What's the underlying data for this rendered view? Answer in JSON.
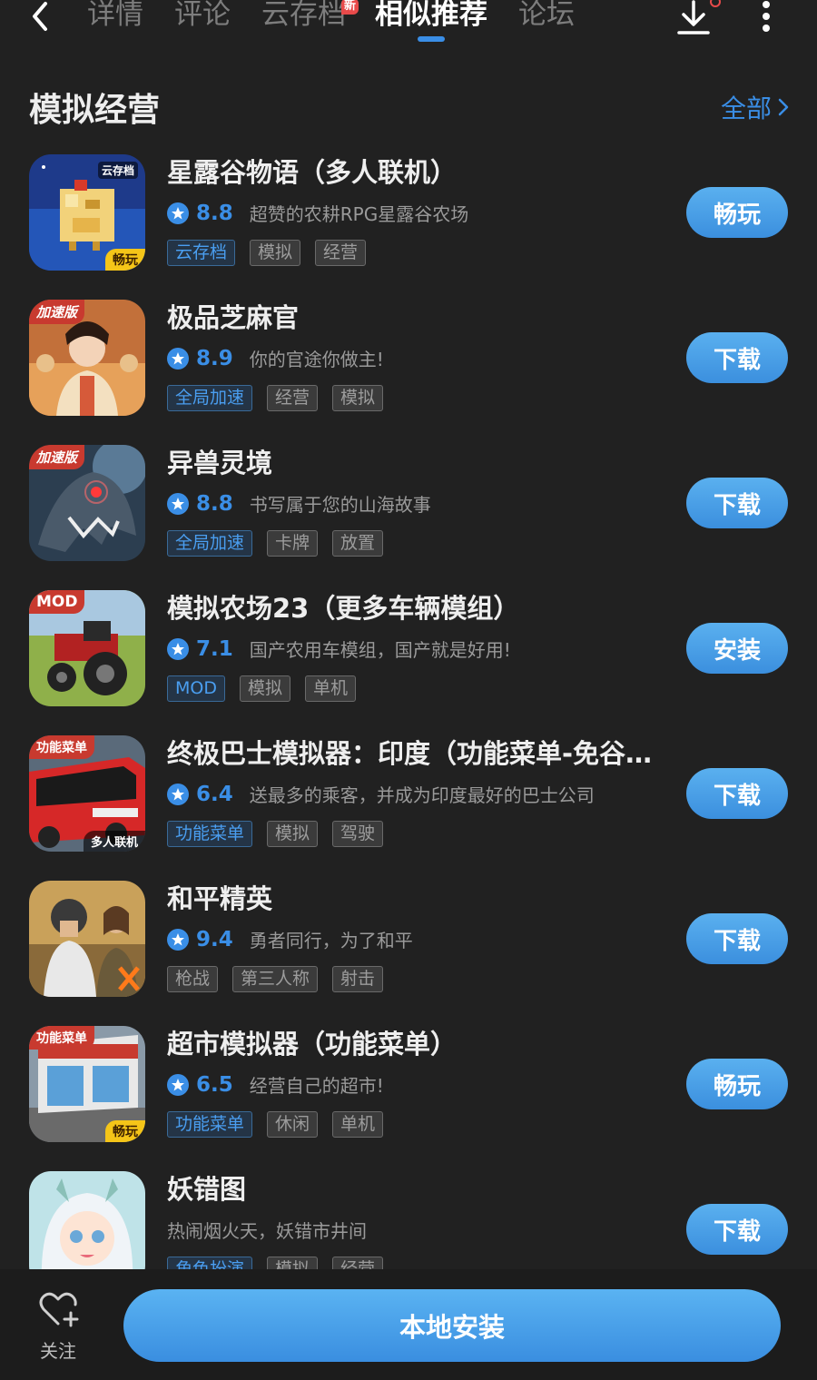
{
  "nav": {
    "tabs": [
      "详情",
      "评论",
      "云存档",
      "相似推荐",
      "论坛"
    ],
    "new_badge": "新",
    "active_tab": "相似推荐"
  },
  "section": {
    "title": "模拟经营",
    "all_label": "全部"
  },
  "apps": [
    {
      "name": "星露谷物语（多人联机）",
      "score": "8.8",
      "desc": "超赞的农耕RPG星露谷农场",
      "tags": [
        "云存档",
        "模拟",
        "经营"
      ],
      "action": "畅玩",
      "corner": "",
      "top_right": "云存档",
      "bottom_right": "畅玩"
    },
    {
      "name": "极品芝麻官",
      "score": "8.9",
      "desc": "你的官途你做主!",
      "tags": [
        "全局加速",
        "经营",
        "模拟"
      ],
      "action": "下载",
      "corner": "加速版"
    },
    {
      "name": "异兽灵境",
      "score": "8.8",
      "desc": "书写属于您的山海故事",
      "tags": [
        "全局加速",
        "卡牌",
        "放置"
      ],
      "action": "下载",
      "corner": "加速版"
    },
    {
      "name": "模拟农场23（更多车辆模组）",
      "score": "7.1",
      "desc": "国产农用车模组，国产就是好用!",
      "tags": [
        "MOD",
        "模拟",
        "单机"
      ],
      "action": "安装",
      "corner": "MOD"
    },
    {
      "name": "终极巴士模拟器：印度（功能菜单-免谷歌...",
      "score": "6.4",
      "desc": "送最多的乘客，并成为印度最好的巴士公司",
      "tags": [
        "功能菜单",
        "模拟",
        "驾驶"
      ],
      "action": "下载",
      "corner": "功能菜单",
      "bottom_right": "多人联机"
    },
    {
      "name": "和平精英",
      "score": "9.4",
      "desc": "勇者同行，为了和平",
      "tags": [
        "枪战",
        "第三人称",
        "射击"
      ],
      "action": "下载",
      "corner": ""
    },
    {
      "name": "超市模拟器（功能菜单）",
      "score": "6.5",
      "desc": "经营自己的超市!",
      "tags": [
        "功能菜单",
        "休闲",
        "单机"
      ],
      "action": "畅玩",
      "corner": "功能菜单",
      "bottom_right": "畅玩"
    },
    {
      "name": "妖错图",
      "score": "",
      "desc": "热闹烟火天，妖错市井间",
      "tags": [
        "角色扮演",
        "模拟",
        "经营"
      ],
      "action": "下载",
      "corner": ""
    }
  ],
  "colors": {
    "accent": "#3a8ee6",
    "background": "#212121",
    "tag_blue": "#4a9ef0"
  },
  "bottom_bar": {
    "follow_label": "关注",
    "install_label": "本地安装"
  }
}
